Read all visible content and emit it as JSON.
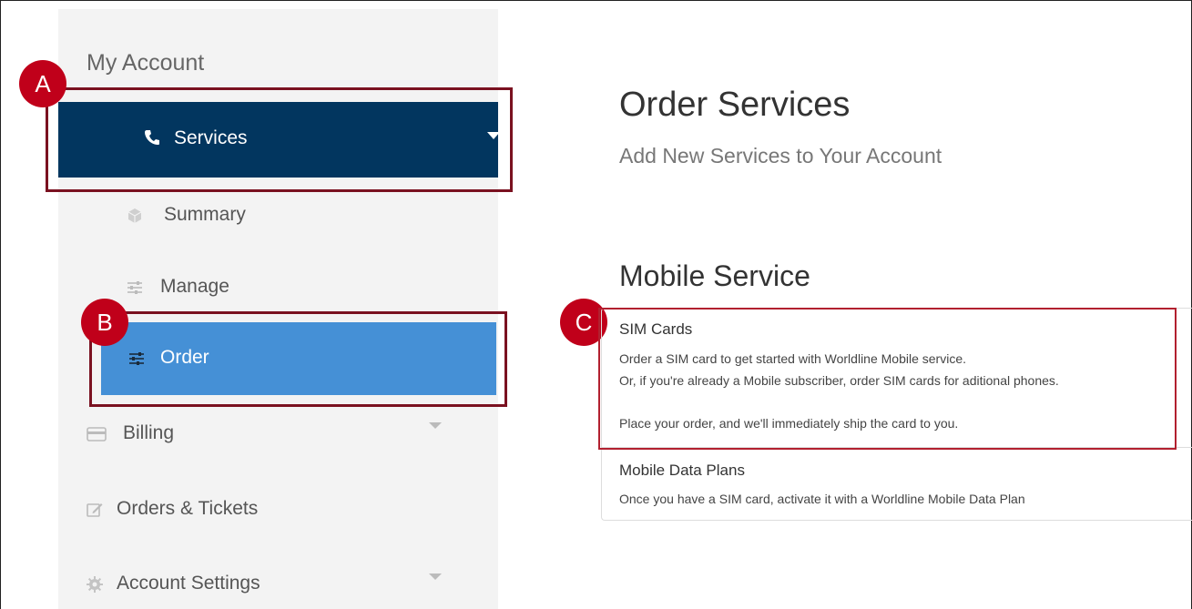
{
  "sidebar": {
    "title": "My Account",
    "services": {
      "label": "Services"
    },
    "summary": {
      "label": "Summary"
    },
    "manage": {
      "label": "Manage"
    },
    "order": {
      "label": "Order"
    },
    "billing": {
      "label": "Billing"
    },
    "orders_tickets": {
      "label": "Orders & Tickets"
    },
    "account_settings": {
      "label": "Account Settings"
    }
  },
  "main": {
    "title": "Order Services",
    "subtitle": "Add New Services to Your Account",
    "section_title": "Mobile Service",
    "items": [
      {
        "title": "SIM Cards",
        "line1": "Order a SIM card to get started with Worldline Mobile service.",
        "line2": "Or, if you're already a Mobile subscriber, order SIM cards for aditional phones.",
        "line3": "Place your order, and we'll immediately ship the card to you."
      },
      {
        "title": "Mobile Data Plans",
        "line1": "Once you have a SIM card, activate it with a Worldline Mobile Data Plan"
      }
    ]
  },
  "annotations": {
    "a": "A",
    "b": "B",
    "c": "C"
  },
  "colors": {
    "nav_dark": "#02365f",
    "nav_active": "#4590d6",
    "annotation": "#c0001a",
    "highlight_border": "#7a1120"
  }
}
